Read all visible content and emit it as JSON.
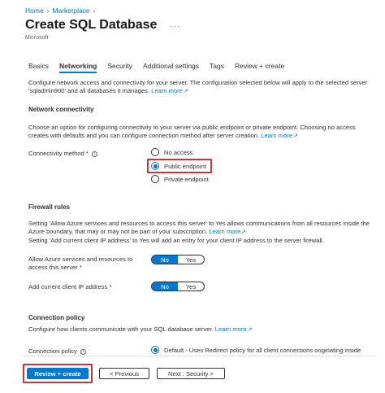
{
  "breadcrumb": {
    "home": "Home",
    "marketplace": "Marketplace"
  },
  "header": {
    "title": "Create SQL Database",
    "subtitle": "Microsoft",
    "more": "···"
  },
  "tabs": [
    {
      "label": "Basics"
    },
    {
      "label": "Networking",
      "active": true
    },
    {
      "label": "Security"
    },
    {
      "label": "Additional settings"
    },
    {
      "label": "Tags"
    },
    {
      "label": "Review + create"
    }
  ],
  "intro": {
    "text": "Configure network access and connectivity for your server. The configuration selected below will apply to the selected server 'sqladmin900' and all databases it manages.",
    "learn_more": "Learn more"
  },
  "network_connectivity": {
    "heading": "Network connectivity",
    "text": "Choose an option for configuring connectivity to your server via public endpoint or private endpoint. Choosing no access creates with defaults and you can configure connection method after server creation.",
    "learn_more": "Learn more",
    "method_label": "Connectivity method *",
    "options": [
      {
        "label": "No access",
        "selected": false
      },
      {
        "label": "Public endpoint",
        "selected": true
      },
      {
        "label": "Private endpoint",
        "selected": false
      }
    ]
  },
  "firewall": {
    "heading": "Firewall rules",
    "text": "Setting 'Allow Azure services and resources to access this server' to Yes allows communications from all resources inside the Azure boundary, that may or may not be part of your subscription.",
    "learn_more": "Learn more",
    "text2": "Setting 'Add current client IP address' to Yes will add an entry for your client IP address to the server firewall.",
    "allow_azure_label": "Allow Azure services and resources to access this server *",
    "client_ip_label": "Add current client IP address *",
    "toggle_no": "No",
    "toggle_yes": "Yes",
    "allow_azure_value": "No",
    "client_ip_value": "No"
  },
  "connection_policy": {
    "heading": "Connection policy",
    "text": "Configure how clients communicate with your SQL database server.",
    "learn_more": "Learn more",
    "label": "Connection policy",
    "default_option": "Default - Uses Redirect policy for all client connections originating inside"
  },
  "footer": {
    "review_create": "Review + create",
    "previous": "< Previous",
    "next": "Next : Security >"
  },
  "colors": {
    "accent": "#0078d4",
    "highlight": "#d13438"
  }
}
